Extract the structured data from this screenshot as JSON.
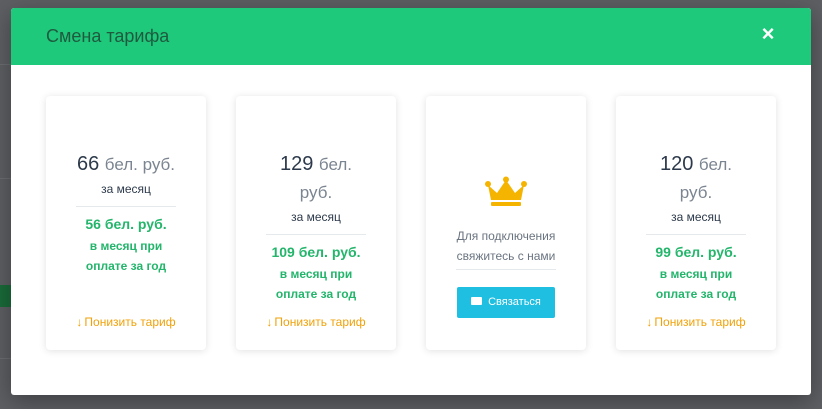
{
  "modal": {
    "title": "Смена тарифа",
    "close_icon": "close-icon"
  },
  "plans": [
    {
      "price_amount": "66",
      "price_currency": "бел. руб.",
      "period": "за месяц",
      "annual_price": "56 бел. руб.",
      "annual_note_1": "в месяц при",
      "annual_note_2": "оплате за год",
      "action_label": "Понизить тариф",
      "action_icon": "arrow-down-icon"
    },
    {
      "price_amount": "129",
      "price_currency_1": "бел.",
      "price_currency_2": "руб.",
      "period": "за месяц",
      "annual_price": "109 бел. руб.",
      "annual_note_1": "в месяц при",
      "annual_note_2": "оплате за год",
      "action_label": "Понизить тариф",
      "action_icon": "arrow-down-icon"
    },
    {
      "icon": "crown-icon",
      "contact_text_1": "Для подключения",
      "contact_text_2": "свяжитесь с нами",
      "button_label": "Связаться",
      "button_icon": "envelope-icon"
    },
    {
      "price_amount": "120",
      "price_currency_1": "бел.",
      "price_currency_2": "руб.",
      "period": "за месяц",
      "annual_price": "99 бел. руб.",
      "annual_note_1": "в месяц при",
      "annual_note_2": "оплате за год",
      "action_label": "Понизить тариф",
      "action_icon": "arrow-down-icon"
    }
  ],
  "colors": {
    "header": "#1ec97b",
    "accent_green": "#23b56b",
    "warning": "#f0a20a",
    "info": "#1ebfe1",
    "crown": "#f5b400"
  }
}
